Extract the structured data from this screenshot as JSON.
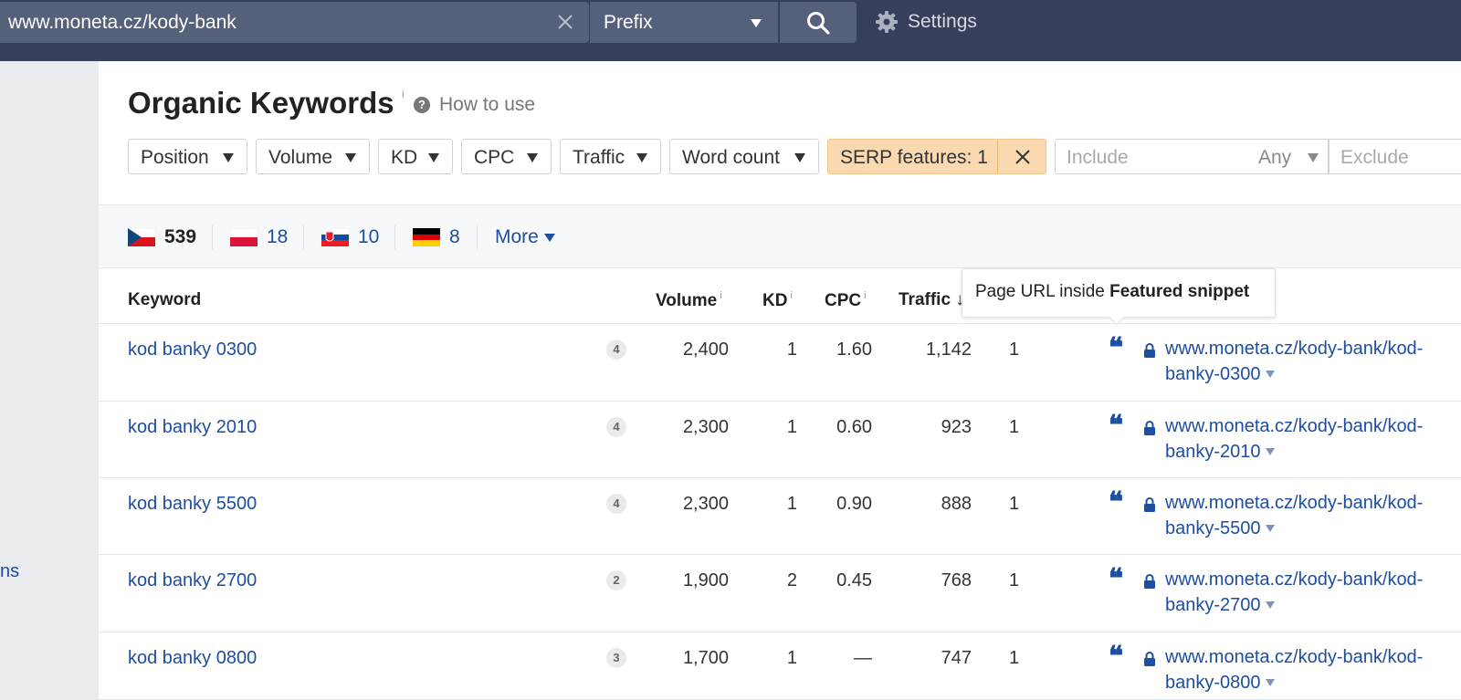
{
  "topbar": {
    "url_value": "www.moneta.cz/kody-bank",
    "mode": "Prefix",
    "settings_label": "Settings",
    "bg_color": "#36405a"
  },
  "sidebar": {
    "partial_text": "ns"
  },
  "page": {
    "title": "Organic Keywords",
    "title_info": "i",
    "how_to_use": "How to use"
  },
  "filters": {
    "buttons": [
      "Position",
      "Volume",
      "KD",
      "CPC",
      "Traffic",
      "Word count"
    ],
    "serp_features": "SERP features: 1",
    "serp_color": "#fbd9b0",
    "include_placeholder": "Include",
    "include_mode": "Any",
    "exclude_placeholder": "Exclude"
  },
  "countries": {
    "items": [
      {
        "flag": "czech-flag",
        "count": "539"
      },
      {
        "flag": "poland-flag",
        "count": "18"
      },
      {
        "flag": "slovakia-flag",
        "count": "10"
      },
      {
        "flag": "germany-flag",
        "count": "8"
      }
    ],
    "more_label": "More"
  },
  "table": {
    "headers": {
      "keyword": "Keyword",
      "volume": "Volume",
      "kd": "KD",
      "cpc": "CPC",
      "traffic": "Traffic",
      "sort_arrow": "↓",
      "info": "i"
    },
    "rows": [
      {
        "keyword": "kod banky 0300",
        "badge": "4",
        "volume": "2,400",
        "kd": "1",
        "cpc": "1.60",
        "traffic": "1,142",
        "position": "1",
        "url": "www.moneta.cz/kody-bank/kod-banky-0300"
      },
      {
        "keyword": "kod banky 2010",
        "badge": "4",
        "volume": "2,300",
        "kd": "1",
        "cpc": "0.60",
        "traffic": "923",
        "position": "1",
        "url": "www.moneta.cz/kody-bank/kod-banky-2010"
      },
      {
        "keyword": "kod banky 5500",
        "badge": "4",
        "volume": "2,300",
        "kd": "1",
        "cpc": "0.90",
        "traffic": "888",
        "position": "1",
        "url": "www.moneta.cz/kody-bank/kod-banky-5500"
      },
      {
        "keyword": "kod banky 2700",
        "badge": "2",
        "volume": "1,900",
        "kd": "2",
        "cpc": "0.45",
        "traffic": "768",
        "position": "1",
        "url": "www.moneta.cz/kody-bank/kod-banky-2700"
      },
      {
        "keyword": "kod banky 0800",
        "badge": "3",
        "volume": "1,700",
        "kd": "1",
        "cpc": "—",
        "traffic": "747",
        "position": "1",
        "url": "www.moneta.cz/kody-bank/kod-banky-0800"
      }
    ],
    "featured_snippet_glyph": "❝"
  },
  "tooltip": {
    "prefix": "Page URL inside ",
    "bold": "Featured snippet"
  },
  "colors": {
    "link": "#1d4ea0"
  }
}
